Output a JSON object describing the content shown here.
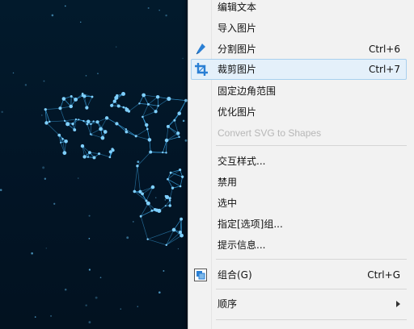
{
  "menu": {
    "items": [
      {
        "label": "编辑文本",
        "shortcut": ""
      },
      {
        "label": "导入图片",
        "shortcut": ""
      },
      {
        "label": "分割图片",
        "shortcut": "Ctrl+6"
      },
      {
        "label": "裁剪图片",
        "shortcut": "Ctrl+7"
      },
      {
        "label": "固定边角范围",
        "shortcut": ""
      },
      {
        "label": "优化图片",
        "shortcut": ""
      },
      {
        "label": "Convert SVG to Shapes",
        "shortcut": ""
      },
      {
        "label": "交互样式...",
        "shortcut": ""
      },
      {
        "label": "禁用",
        "shortcut": ""
      },
      {
        "label": "选中",
        "shortcut": ""
      },
      {
        "label": "指定[选项]组...",
        "shortcut": ""
      },
      {
        "label": "提示信息...",
        "shortcut": ""
      },
      {
        "label": "组合(G)",
        "shortcut": "Ctrl+G"
      },
      {
        "label": "顺序",
        "shortcut": ""
      }
    ]
  },
  "colors": {
    "highlight": "#e4f0fa",
    "highlight_border": "#a8d0ee",
    "canvas_bg": "#021a2c",
    "network": "#3da8e8",
    "icon_blue": "#2a7fd4",
    "top_strip": "#5fbf5f"
  },
  "icons": {
    "split": "pen-nib-icon",
    "crop": "crop-icon",
    "group": "group-icon",
    "submenu": "chevron-right-icon"
  }
}
